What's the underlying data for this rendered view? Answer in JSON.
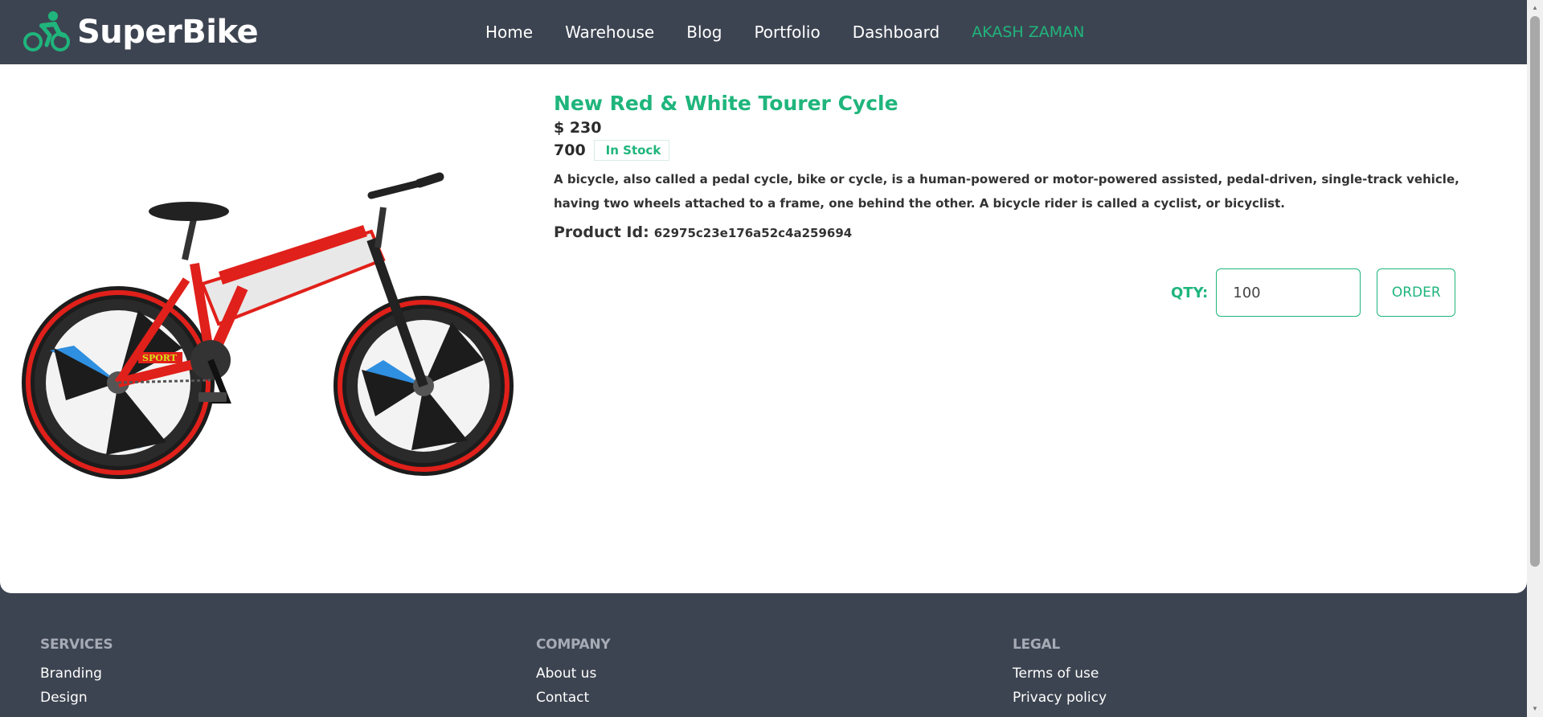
{
  "brand": {
    "name": "SuperBike"
  },
  "nav": {
    "links": [
      "Home",
      "Warehouse",
      "Blog",
      "Portfolio",
      "Dashboard"
    ],
    "user": "AKASH ZAMAN"
  },
  "product": {
    "title": "New Red & White Tourer Cycle",
    "price": "$ 230",
    "quantity": "700",
    "stock_status": "In Stock",
    "description": "A bicycle, also called a pedal cycle, bike or cycle, is a human-powered or motor-powered assisted, pedal-driven, single-track vehicle, having two wheels attached to a frame, one behind the other. A bicycle rider is called a cyclist, or bicyclist.",
    "id_label": "Product Id:",
    "id_value": "62975c23e176a52c4a259694"
  },
  "order": {
    "qty_label": "QTY:",
    "qty_value": "100",
    "button_label": "ORDER"
  },
  "footer": {
    "services": {
      "heading": "SERVICES",
      "links": [
        "Branding",
        "Design"
      ]
    },
    "company": {
      "heading": "COMPANY",
      "links": [
        "About us",
        "Contact"
      ]
    },
    "legal": {
      "heading": "LEGAL",
      "links": [
        "Terms of use",
        "Privacy policy"
      ]
    }
  },
  "colors": {
    "accent": "#1fb57c",
    "navbar": "#3d4451",
    "bike_red": "#e0201a",
    "bike_blue": "#2f8fe0"
  }
}
